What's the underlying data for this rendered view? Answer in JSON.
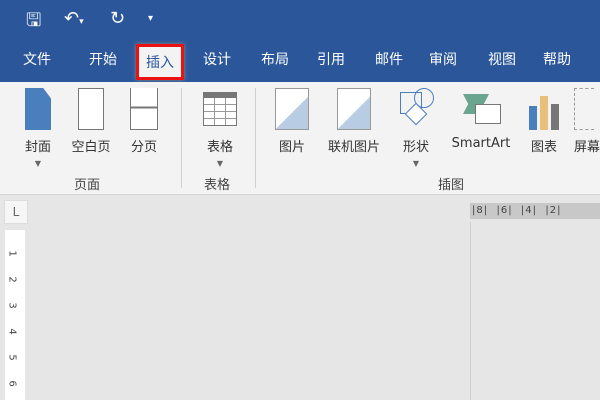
{
  "qat": {
    "save": "save-icon",
    "undo": "undo-icon",
    "redo": "redo-icon",
    "customize": "customize-icon"
  },
  "tabs": [
    "文件",
    "开始",
    "插入",
    "设计",
    "布局",
    "引用",
    "邮件",
    "审阅",
    "视图",
    "帮助"
  ],
  "active_tab": "插入",
  "ribbon": {
    "pages": {
      "cover": "封面",
      "blank": "空白页",
      "break": "分页",
      "group": "页面"
    },
    "tables": {
      "table": "表格",
      "group": "表格"
    },
    "illustrations": {
      "picture": "图片",
      "online": "联机图片",
      "shapes": "形状",
      "smartart": "SmartArt",
      "chart": "图表",
      "screenshot": "屏幕",
      "group": "插图"
    }
  },
  "ruler": {
    "horizontal": "|8|  |6|  |4|  |2|",
    "vertical": [
      "1",
      "2",
      "3",
      "4",
      "5",
      "6"
    ],
    "tab_selector": "L"
  }
}
